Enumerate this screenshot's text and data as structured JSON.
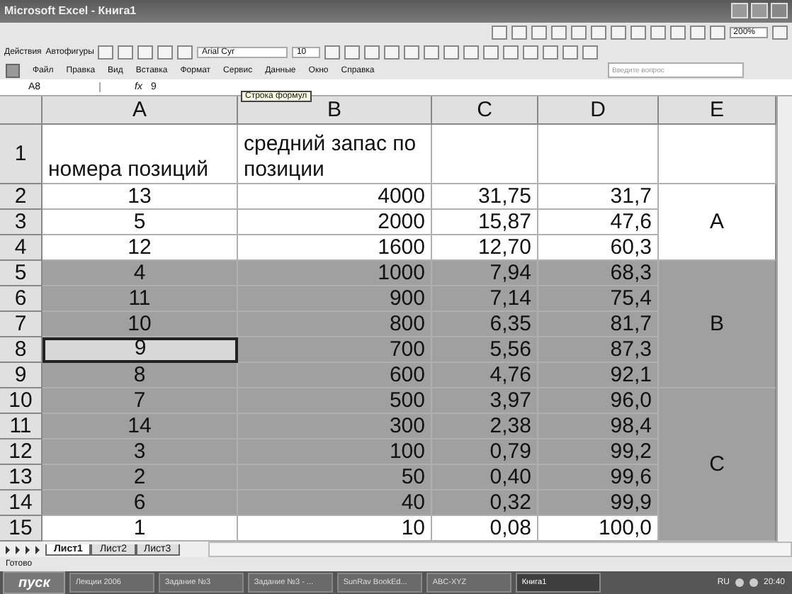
{
  "window": {
    "title": "Microsoft Excel - Книга1"
  },
  "toolbar": {
    "draw_menu": "Действия",
    "autoshapes": "Автофигуры",
    "font": "Arial Cyr",
    "size": "10",
    "zoom": "200%"
  },
  "menu": [
    "Файл",
    "Правка",
    "Вид",
    "Вставка",
    "Формат",
    "Сервис",
    "Данные",
    "Окно",
    "Справка"
  ],
  "help_search": {
    "placeholder": "Введите вопрос"
  },
  "formula_bar": {
    "name_box": "A8",
    "fx": "fx",
    "value": "9",
    "tooltip": "Строка формул"
  },
  "columns": [
    "A",
    "B",
    "C",
    "D",
    "E"
  ],
  "header_row": {
    "num": "1",
    "cells": [
      "номера позиций",
      "средний запас по позиции"
    ]
  },
  "groups": [
    {
      "label": "A",
      "shaded": false,
      "rows": [
        {
          "num": "2",
          "cells": [
            "13",
            "4000",
            "31,75",
            "31,7"
          ],
          "shaded": false,
          "selected": false
        },
        {
          "num": "3",
          "cells": [
            "5",
            "2000",
            "15,87",
            "47,6"
          ],
          "shaded": false,
          "selected": false
        },
        {
          "num": "4",
          "cells": [
            "12",
            "1600",
            "12,70",
            "60,3"
          ],
          "shaded": false,
          "selected": false
        }
      ]
    },
    {
      "label": "B",
      "shaded": true,
      "rows": [
        {
          "num": "5",
          "cells": [
            "4",
            "1000",
            "7,94",
            "68,3"
          ],
          "shaded": true,
          "selected": false
        },
        {
          "num": "6",
          "cells": [
            "11",
            "900",
            "7,14",
            "75,4"
          ],
          "shaded": true,
          "selected": false
        },
        {
          "num": "7",
          "cells": [
            "10",
            "800",
            "6,35",
            "81,7"
          ],
          "shaded": true,
          "selected": false
        },
        {
          "num": "8",
          "cells": [
            "9",
            "700",
            "5,56",
            "87,3"
          ],
          "shaded": true,
          "selected": true
        },
        {
          "num": "9",
          "cells": [
            "8",
            "600",
            "4,76",
            "92,1"
          ],
          "shaded": true,
          "selected": false
        }
      ]
    },
    {
      "label": "C",
      "shaded": true,
      "rows": [
        {
          "num": "10",
          "cells": [
            "7",
            "500",
            "3,97",
            "96,0"
          ],
          "shaded": true,
          "selected": false
        },
        {
          "num": "11",
          "cells": [
            "14",
            "300",
            "2,38",
            "98,4"
          ],
          "shaded": true,
          "selected": false
        },
        {
          "num": "12",
          "cells": [
            "3",
            "100",
            "0,79",
            "99,2"
          ],
          "shaded": true,
          "selected": false
        },
        {
          "num": "13",
          "cells": [
            "2",
            "50",
            "0,40",
            "99,6"
          ],
          "shaded": true,
          "selected": false
        },
        {
          "num": "14",
          "cells": [
            "6",
            "40",
            "0,32",
            "99,9"
          ],
          "shaded": true,
          "selected": false
        },
        {
          "num": "15",
          "cells": [
            "1",
            "10",
            "0,08",
            "100,0"
          ],
          "shaded": false,
          "selected": false
        }
      ]
    }
  ],
  "sheet_tabs": [
    {
      "label": "Лист1",
      "selected": true
    },
    {
      "label": "Лист2",
      "selected": false
    },
    {
      "label": "Лист3",
      "selected": false
    }
  ],
  "status_bar": "Готово",
  "taskbar": {
    "start": "пуск",
    "buttons": [
      {
        "label": "Лекции 2006",
        "selected": false
      },
      {
        "label": "Задание №3",
        "selected": false
      },
      {
        "label": "Задание №3 - ...",
        "selected": false
      },
      {
        "label": "SunRav BookEd...",
        "selected": false
      },
      {
        "label": "ABC-XYZ",
        "selected": false
      },
      {
        "label": "Книга1",
        "selected": true
      }
    ],
    "lang": "RU",
    "time": "20:40"
  }
}
